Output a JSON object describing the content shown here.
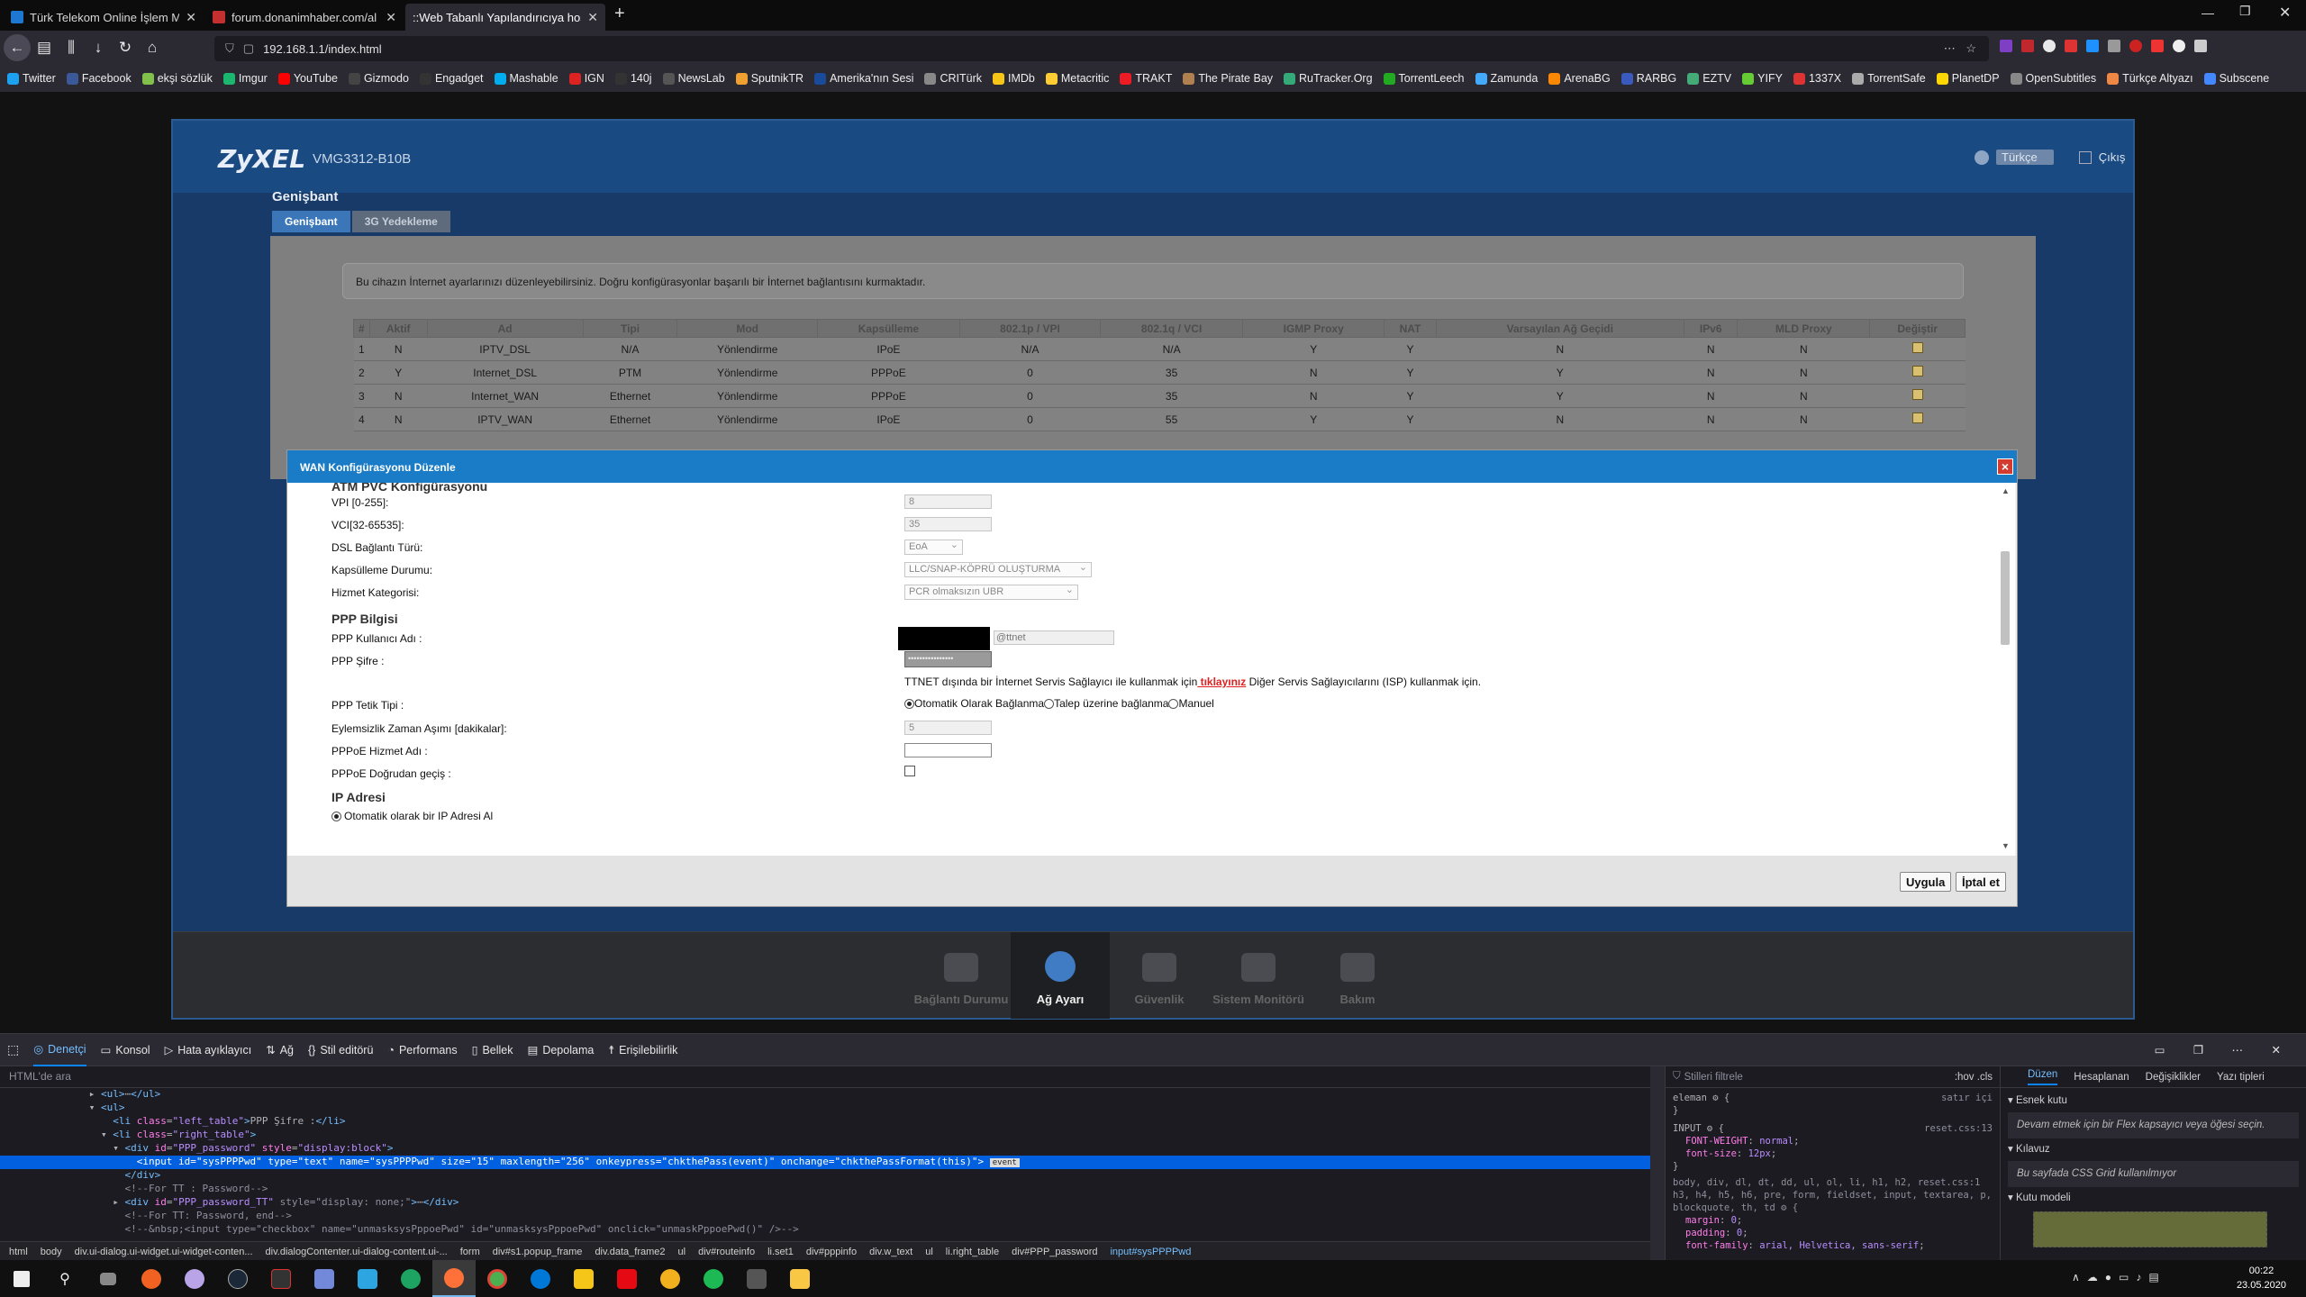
{
  "browser": {
    "tabs": [
      {
        "title": "Türk Telekom Online İşlem Me",
        "color": "#1e78d2"
      },
      {
        "title": "forum.donanimhaber.com/al",
        "color": "#c43030"
      },
      {
        "title": "::Web Tabanlı Yapılandırıcıya hoş g",
        "color": "#444"
      }
    ],
    "url": "192.168.1.1/index.html",
    "bookmarks": [
      {
        "label": "Twitter",
        "color": "#1da1f2"
      },
      {
        "label": "Facebook",
        "color": "#3b5998"
      },
      {
        "label": "ekşi sözlük",
        "color": "#81c14b"
      },
      {
        "label": "Imgur",
        "color": "#1bb76e"
      },
      {
        "label": "YouTube",
        "color": "#ff0000"
      },
      {
        "label": "Gizmodo",
        "color": "#444"
      },
      {
        "label": "Engadget",
        "color": "#333"
      },
      {
        "label": "Mashable",
        "color": "#00aeef"
      },
      {
        "label": "IGN",
        "color": "#d22"
      },
      {
        "label": "140j",
        "color": "#333"
      },
      {
        "label": "NewsLab",
        "color": "#555"
      },
      {
        "label": "SputnikTR",
        "color": "#f0a030"
      },
      {
        "label": "Amerika'nın Sesi",
        "color": "#1a4a9a"
      },
      {
        "label": "CRITürk",
        "color": "#888"
      },
      {
        "label": "IMDb",
        "color": "#f5c518"
      },
      {
        "label": "Metacritic",
        "color": "#ffcc33"
      },
      {
        "label": "TRAKT",
        "color": "#ed1c24"
      },
      {
        "label": "The Pirate Bay",
        "color": "#b08050"
      },
      {
        "label": "RuTracker.Org",
        "color": "#3a7"
      },
      {
        "label": "TorrentLeech",
        "color": "#2a2"
      },
      {
        "label": "Zamunda",
        "color": "#4af"
      },
      {
        "label": "ArenaBG",
        "color": "#f80"
      },
      {
        "label": "RARBG",
        "color": "#3a5ac0"
      },
      {
        "label": "EZTV",
        "color": "#4a7"
      },
      {
        "label": "YIFY",
        "color": "#6c3"
      },
      {
        "label": "1337X",
        "color": "#d33"
      },
      {
        "label": "TorrentSafe",
        "color": "#aaa"
      },
      {
        "label": "PlanetDP",
        "color": "#ffd700"
      },
      {
        "label": "OpenSubtitles",
        "color": "#888"
      },
      {
        "label": "Türkçe Altyazı",
        "color": "#e84"
      },
      {
        "label": "Subscene",
        "color": "#48f"
      }
    ]
  },
  "router": {
    "logo": "ZyXEL",
    "model": "VMG3312-B10B",
    "language": "Türkçe",
    "logout": "Çıkış",
    "page_title": "Genişbant",
    "tabs": [
      "Genişbant",
      "3G Yedekleme"
    ],
    "info": "Bu cihazın İnternet ayarlarınızı düzenleyebilirsiniz. Doğru konfigürasyonlar başarılı bir İnternet bağlantısını kurmaktadır.",
    "table": {
      "headers": [
        "#",
        "Aktif",
        "Ad",
        "Tipi",
        "Mod",
        "Kapsülleme",
        "802.1p / VPI",
        "802.1q / VCI",
        "IGMP Proxy",
        "NAT",
        "Varsayılan Ağ Geçidi",
        "IPv6",
        "MLD Proxy",
        "Değiştir"
      ],
      "rows": [
        [
          "1",
          "N",
          "IPTV_DSL",
          "N/A",
          "Yönlendirme",
          "IPoE",
          "N/A",
          "N/A",
          "Y",
          "Y",
          "N",
          "N",
          "N"
        ],
        [
          "2",
          "Y",
          "Internet_DSL",
          "PTM",
          "Yönlendirme",
          "PPPoE",
          "0",
          "35",
          "N",
          "Y",
          "Y",
          "N",
          "N"
        ],
        [
          "3",
          "N",
          "Internet_WAN",
          "Ethernet",
          "Yönlendirme",
          "PPPoE",
          "0",
          "35",
          "N",
          "Y",
          "Y",
          "N",
          "N"
        ],
        [
          "4",
          "N",
          "IPTV_WAN",
          "Ethernet",
          "Yönlendirme",
          "IPoE",
          "0",
          "55",
          "Y",
          "Y",
          "N",
          "N",
          "N"
        ]
      ]
    },
    "dock": [
      "Bağlantı Durumu",
      "Ağ Ayarı",
      "Güvenlik",
      "Sistem Monitörü",
      "Bakım"
    ]
  },
  "dialog": {
    "title": "WAN Konfigürasyonu Düzenle",
    "atm_section": "ATM PVC Konfigürasyonu",
    "vpi_label": "VPI [0-255]:",
    "vpi_value": "8",
    "vci_label": "VCI[32-65535]:",
    "vci_value": "35",
    "dsl_label": "DSL Bağlantı Türü:",
    "dsl_value": "EoA",
    "encap_label": "Kapsülleme Durumu:",
    "encap_value": "LLC/SNAP-KÖPRÜ OLUŞTURMA",
    "service_label": "Hizmet Kategorisi:",
    "service_value": "PCR olmaksızın UBR",
    "ppp_section": "PPP Bilgisi",
    "ppp_user_label": "PPP Kullanıcı Adı :",
    "ppp_user_suffix": "@ttnet",
    "ppp_pass_label": "PPP Şifre :",
    "ppp_pass_value": "••••••••••••••••",
    "ttnet_note_a": "TTNET dışında bir İnternet Servis Sağlayıcı ile kullanmak için",
    "ttnet_link": " tıklayınız",
    "ttnet_note_b": " Diğer Servis Sağlayıcılarını (ISP) kullanmak için.",
    "trigger_label": "PPP Tetik Tipi :",
    "trigger_auto": "Otomatik Olarak Bağlanma",
    "trigger_demand": "Talep üzerine bağlanma",
    "trigger_manual": "Manuel",
    "idle_label": "Eylemsizlik Zaman Aşımı [dakikalar]:",
    "idle_value": "5",
    "pppoe_service_label": "PPPoE Hizmet Adı :",
    "pppoe_pass_label": "PPPoE Doğrudan geçiş :",
    "ip_section": "IP Adresi",
    "ip_auto": "Otomatik olarak bir IP Adresi Al",
    "apply": "Uygula",
    "cancel": "İptal et"
  },
  "devtools": {
    "tabs": [
      "Denetçi",
      "Konsol",
      "Hata ayıklayıcı",
      "Ağ",
      "Stil editörü",
      "Performans",
      "Bellek",
      "Depolama",
      "Erişilebilirlik"
    ],
    "search_placeholder": "HTML'de ara",
    "filter_placeholder": "Stilleri filtrele",
    "pseudo": ":hov .cls",
    "layout_tabs": [
      "Düzen",
      "Hesaplanan",
      "Değişiklikler",
      "Yazı tipleri"
    ],
    "flex_title": "Esnek kutu",
    "flex_text": "Devam etmek için bir Flex kapsayıcı veya öğesi seçin.",
    "grid_title": "Kılavuz",
    "grid_text": "Bu sayfada CSS Grid kullanılmıyor",
    "box_title": "Kutu modeli",
    "crumbs": [
      "html",
      "body",
      "div.ui-dialog.ui-widget.ui-widget-conten...",
      "div.dialogContenter.ui-dialog-content.ui-...",
      "form",
      "div#s1.popup_frame",
      "div.data_frame2",
      "ul",
      "div#routeinfo",
      "li.set1",
      "div#pppinfo",
      "div.w_text",
      "ul",
      "li.right_table",
      "div#PPP_password",
      "input#sysPPPPwd"
    ]
  },
  "taskbar": {
    "time": "00:22",
    "date": "23.05.2020"
  }
}
